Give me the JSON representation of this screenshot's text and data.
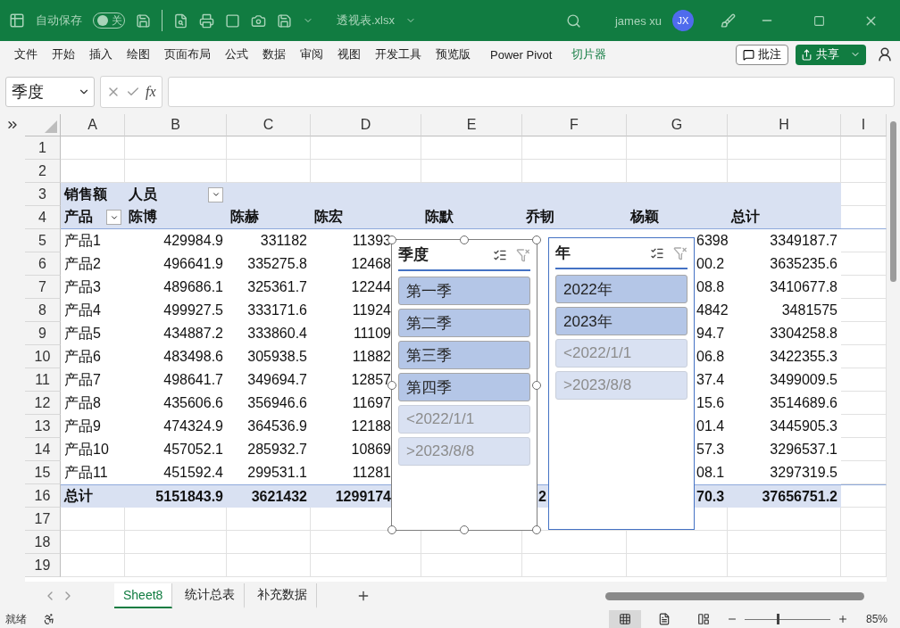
{
  "title_bar": {
    "autosave_label": "自动保存",
    "autosave": {
      "on": false,
      "state_label": "关"
    },
    "file_name": "透视表.xlsx",
    "user_name": "james xu",
    "avatar_initials": "JX"
  },
  "ribbon": {
    "tabs": [
      {
        "label": "文件",
        "selected": false
      },
      {
        "label": "开始",
        "selected": false
      },
      {
        "label": "插入",
        "selected": false
      },
      {
        "label": "绘图",
        "selected": false
      },
      {
        "label": "页面布局",
        "selected": false
      },
      {
        "label": "公式",
        "selected": false
      },
      {
        "label": "数据",
        "selected": false
      },
      {
        "label": "审阅",
        "selected": false
      },
      {
        "label": "视图",
        "selected": false
      },
      {
        "label": "开发工具",
        "selected": false
      },
      {
        "label": "预览版",
        "selected": false
      },
      {
        "label": "Power Pivot",
        "selected": false
      },
      {
        "label": "切片器",
        "selected": true
      }
    ],
    "comment_button": "批注",
    "share_button": "共享"
  },
  "formula_bar": {
    "name_box": "季度",
    "fx": "fx"
  },
  "sheet": {
    "columns": [
      "A",
      "B",
      "C",
      "D",
      "E",
      "F",
      "G",
      "H",
      "I"
    ],
    "rows": [
      {
        "number": "1",
        "kind": "blank"
      },
      {
        "number": "2",
        "kind": "blank"
      },
      {
        "number": "3",
        "kind": "pivot-header",
        "cells": [
          "销售额",
          {
            "text": "人员",
            "dropdown": true
          },
          null,
          null,
          null,
          null,
          null,
          null
        ]
      },
      {
        "number": "4",
        "kind": "pivot-header",
        "cells": [
          {
            "text": "产品",
            "dropdown": true
          },
          "陈博",
          "陈赫",
          "陈宏",
          "陈默",
          "乔韧",
          "杨颖",
          "总计"
        ]
      },
      {
        "number": "5",
        "kind": "data",
        "cells": [
          "产品1",
          "429984.9",
          "331182",
          "11393",
          null,
          null,
          "6398",
          "3349187.7"
        ]
      },
      {
        "number": "6",
        "kind": "data",
        "cells": [
          "产品2",
          "496641.9",
          "335275.8",
          "12468",
          null,
          null,
          "00.2",
          "3635235.6"
        ]
      },
      {
        "number": "7",
        "kind": "data",
        "cells": [
          "产品3",
          "489686.1",
          "325361.7",
          "12244",
          null,
          null,
          "08.8",
          "3410677.8"
        ]
      },
      {
        "number": "8",
        "kind": "data",
        "cells": [
          "产品4",
          "499927.5",
          "333171.6",
          "11924",
          null,
          null,
          "4842",
          "3481575"
        ]
      },
      {
        "number": "9",
        "kind": "data",
        "cells": [
          "产品5",
          "434887.2",
          "333860.4",
          "11109",
          null,
          null,
          "94.7",
          "3304258.8"
        ]
      },
      {
        "number": "10",
        "kind": "data",
        "cells": [
          "产品6",
          "483498.6",
          "305938.5",
          "11882",
          null,
          null,
          "06.8",
          "3422355.3"
        ]
      },
      {
        "number": "11",
        "kind": "data",
        "cells": [
          "产品7",
          "498641.7",
          "349694.7",
          "12857",
          null,
          null,
          "37.4",
          "3499009.5"
        ]
      },
      {
        "number": "12",
        "kind": "data",
        "cells": [
          "产品8",
          "435606.6",
          "356946.6",
          "11697",
          null,
          null,
          "15.6",
          "3514689.6"
        ]
      },
      {
        "number": "13",
        "kind": "data",
        "cells": [
          "产品9",
          "474324.9",
          "364536.9",
          "12188",
          null,
          null,
          "01.4",
          "3445905.3"
        ]
      },
      {
        "number": "14",
        "kind": "data",
        "cells": [
          "产品10",
          "457052.1",
          "285932.7",
          "10869",
          null,
          null,
          "57.3",
          "3296537.1"
        ]
      },
      {
        "number": "15",
        "kind": "data",
        "cells": [
          "产品11",
          "451592.4",
          "299531.1",
          "11281",
          null,
          null,
          "08.1",
          "3297319.5"
        ]
      },
      {
        "number": "16",
        "kind": "total",
        "cells": [
          "总计",
          "5151843.9",
          "3621432",
          "1299174",
          null,
          "2",
          "70.3",
          "37656751.2"
        ]
      },
      {
        "number": "17",
        "kind": "blank"
      },
      {
        "number": "18",
        "kind": "blank"
      },
      {
        "number": "19",
        "kind": "blank"
      }
    ]
  },
  "slicers": [
    {
      "title": "季度",
      "selected": true,
      "items": [
        {
          "label": "第一季",
          "selected": true,
          "has_data": true
        },
        {
          "label": "第二季",
          "selected": true,
          "has_data": true
        },
        {
          "label": "第三季",
          "selected": true,
          "has_data": true
        },
        {
          "label": "第四季",
          "selected": true,
          "has_data": true
        },
        {
          "label": "<2022/1/1",
          "selected": true,
          "has_data": false
        },
        {
          "label": ">2023/8/8",
          "selected": true,
          "has_data": false
        }
      ]
    },
    {
      "title": "年",
      "selected": false,
      "items": [
        {
          "label": "2022年",
          "selected": true,
          "has_data": true
        },
        {
          "label": "2023年",
          "selected": true,
          "has_data": true
        },
        {
          "label": "<2022/1/1",
          "selected": true,
          "has_data": false
        },
        {
          "label": ">2023/8/8",
          "selected": true,
          "has_data": false
        }
      ]
    }
  ],
  "sheet_tabs": [
    {
      "label": "Sheet8",
      "selected": true
    },
    {
      "label": "统计总表",
      "selected": false
    },
    {
      "label": "补充数据",
      "selected": false
    }
  ],
  "status_bar": {
    "status": "就绪",
    "views": [
      {
        "kind": "normal",
        "selected": true
      },
      {
        "kind": "page-layout",
        "selected": false
      },
      {
        "kind": "page-break",
        "selected": false
      }
    ],
    "zoom": {
      "level": 0.38,
      "label": "85%"
    }
  }
}
